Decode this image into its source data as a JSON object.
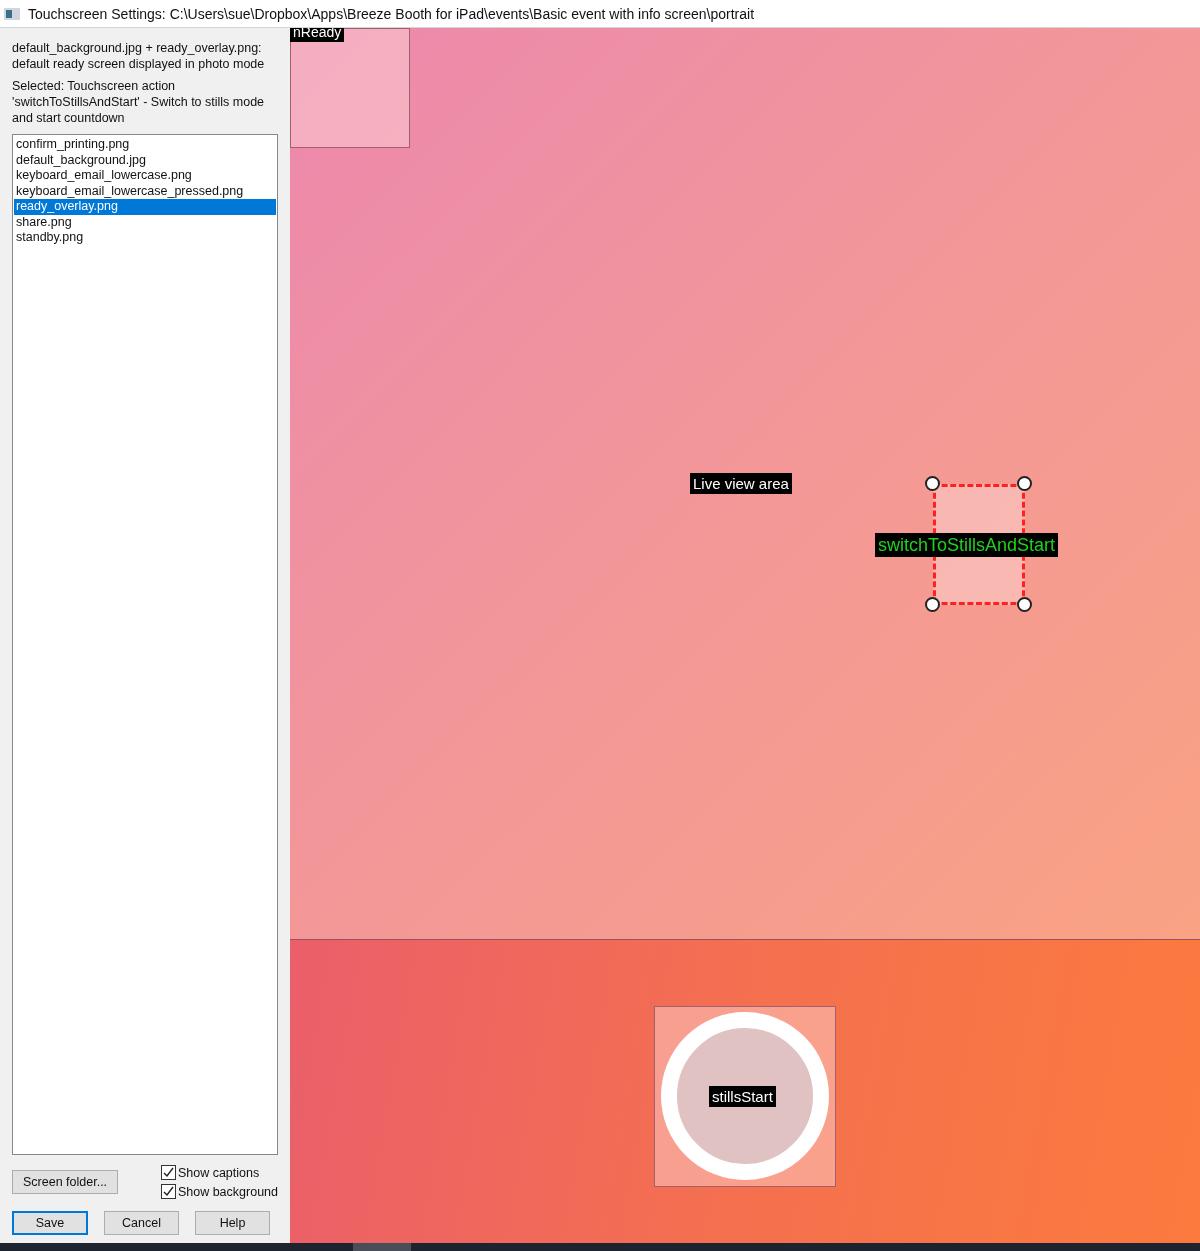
{
  "window": {
    "title": "Touchscreen Settings: C:\\Users\\sue\\Dropbox\\Apps\\Breeze Booth for iPad\\events\\Basic event with info screen\\portrait"
  },
  "description": "default_background.jpg + ready_overlay.png: default ready screen displayed in photo mode",
  "selection_info": "Selected: Touchscreen action 'switchToStillsAndStart' - Switch to stills mode and start countdown",
  "files": [
    {
      "name": "confirm_printing.png",
      "selected": false
    },
    {
      "name": "default_background.jpg",
      "selected": false
    },
    {
      "name": "keyboard_email_lowercase.png",
      "selected": false
    },
    {
      "name": "keyboard_email_lowercase_pressed.png",
      "selected": false
    },
    {
      "name": "ready_overlay.png",
      "selected": true
    },
    {
      "name": "share.png",
      "selected": false
    },
    {
      "name": "standby.png",
      "selected": false
    }
  ],
  "screen_folder_button": "Screen folder...",
  "checkboxes": [
    {
      "label": "Show captions",
      "checked": true
    },
    {
      "label": "Show background",
      "checked": true
    }
  ],
  "buttons": [
    {
      "label": "Save",
      "default": true
    },
    {
      "label": "Cancel",
      "default": false
    },
    {
      "label": "Help",
      "default": false
    }
  ],
  "canvas": {
    "live_view_label": "Live view area",
    "regions": [
      {
        "kind": "area",
        "caption": "nReady",
        "selected": false
      },
      {
        "kind": "area",
        "caption": "switchToStillsAndStart",
        "selected": true
      },
      {
        "kind": "button",
        "caption": "stillsStart",
        "selected": false
      }
    ]
  }
}
